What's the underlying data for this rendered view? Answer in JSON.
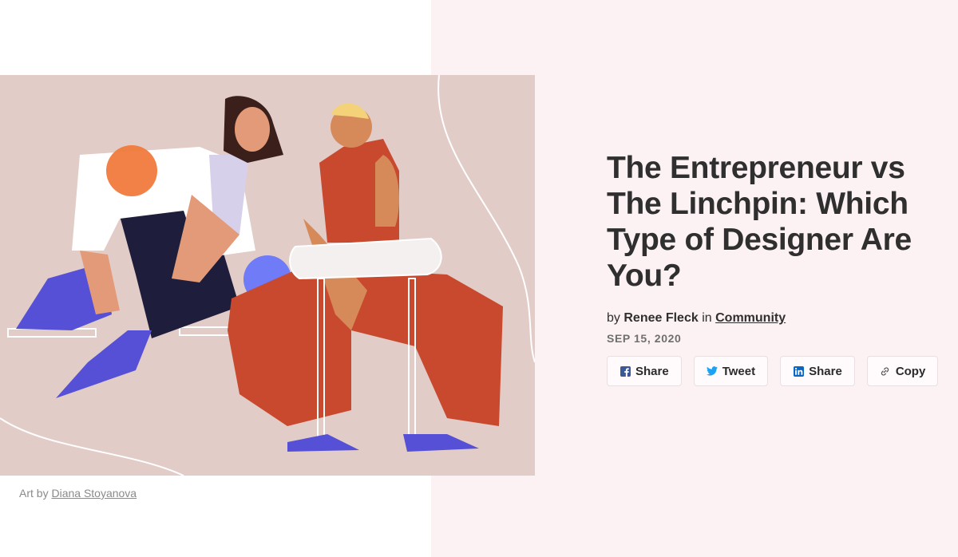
{
  "article": {
    "title": "The Entrepreneur vs The Linchpin: Which Type of Designer Are You?",
    "byline_prefix": "by",
    "author": "Renee Fleck",
    "byline_in": "in",
    "category": "Community",
    "date": "SEP 15, 2020"
  },
  "share_buttons": [
    {
      "label": "Share",
      "icon": "facebook-icon"
    },
    {
      "label": "Tweet",
      "icon": "twitter-icon"
    },
    {
      "label": "Share",
      "icon": "linkedin-icon"
    },
    {
      "label": "Copy",
      "icon": "link-icon"
    }
  ],
  "hero": {
    "caption_prefix": "Art by",
    "artist": "Diana Stoyanova"
  },
  "colors": {
    "right_panel_bg": "#fcf1f3",
    "hero_bg": "#e2ccc8",
    "facebook": "#3b5998",
    "twitter": "#1da1f2",
    "linkedin": "#0a66c2"
  }
}
